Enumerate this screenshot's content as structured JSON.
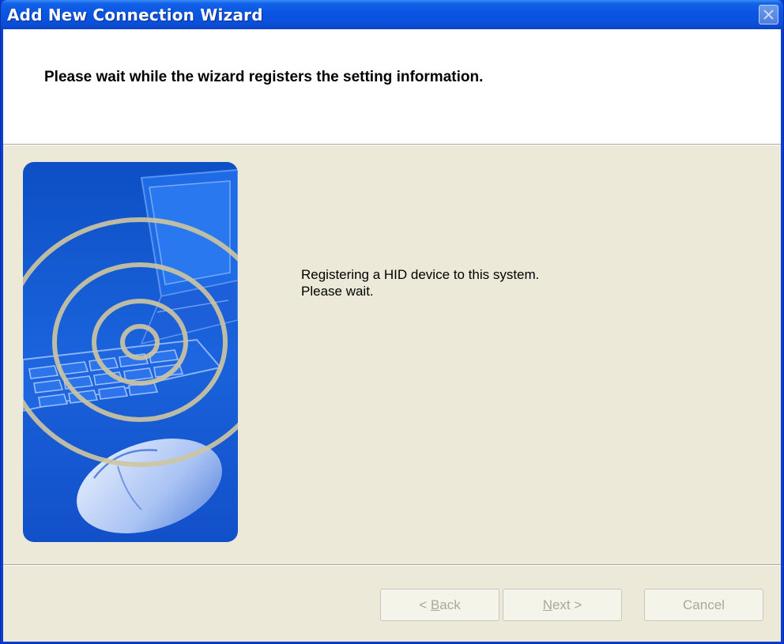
{
  "window": {
    "title": "Add New Connection Wizard"
  },
  "header": {
    "title": "Please wait while the wizard registers the setting information."
  },
  "body": {
    "message_line1": "Registering a HID device to this system.",
    "message_line2": "Please wait."
  },
  "buttons": {
    "back": {
      "prefix": "< ",
      "mnemonic": "B",
      "rest": "ack",
      "enabled": false
    },
    "next": {
      "mnemonic": "N",
      "rest": "ext",
      "suffix": " >",
      "enabled": false
    },
    "cancel": {
      "label": "Cancel",
      "enabled": false
    }
  },
  "icons": {
    "close": "close-icon",
    "illustration": "wireless-keyboard-mouse-illustration"
  },
  "colors": {
    "titlebar": "#0a55e2",
    "dialog_face": "#ece9d8",
    "header_band": "#ffffff",
    "illustration_blue": "#1a5fd6",
    "disabled_text": "#aca899"
  }
}
